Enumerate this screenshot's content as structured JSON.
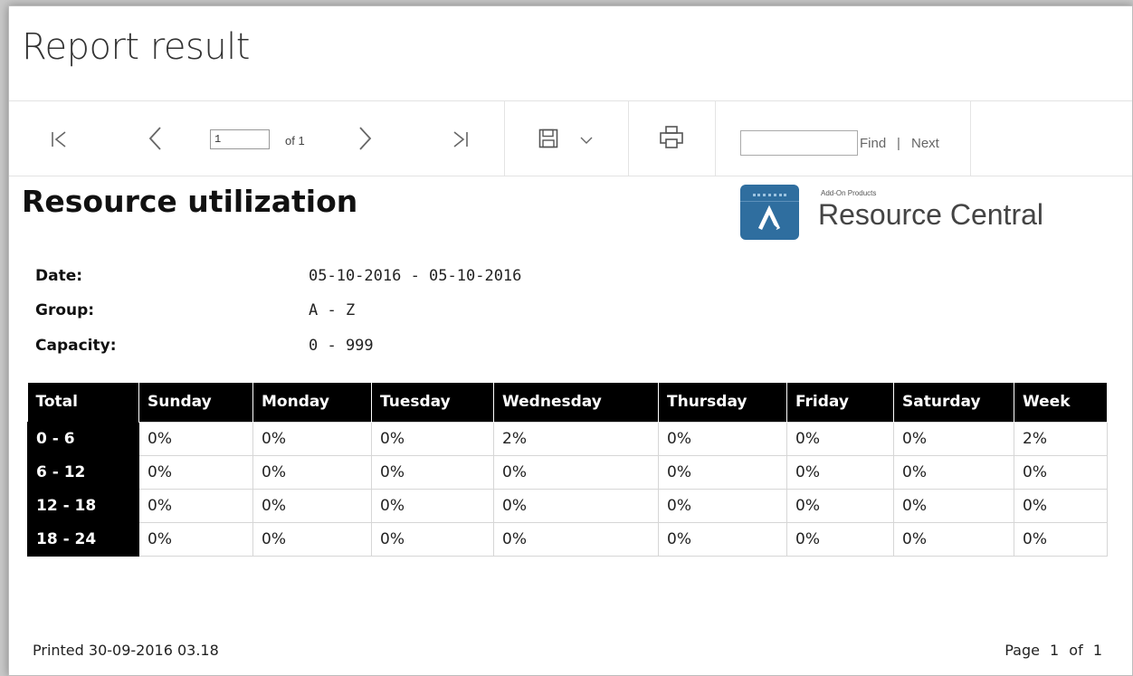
{
  "page_title": "Report result",
  "toolbar": {
    "page_value": "1",
    "of_label": "of 1",
    "find_label": "Find",
    "separator": "|",
    "next_label": "Next"
  },
  "report": {
    "title": "Resource utilization",
    "logo": {
      "small_text": "Add-On Products",
      "name": "Resource Central",
      "color": "#2f6e9f"
    },
    "meta": [
      {
        "label": "Date:",
        "value": "05-10-2016 - 05-10-2016"
      },
      {
        "label": "Group:",
        "value": "A - Z"
      },
      {
        "label": "Capacity:",
        "value": "0 - 999"
      }
    ],
    "table": {
      "headers": [
        "Total",
        "Sunday",
        "Monday",
        "Tuesday",
        "Wednesday",
        "Thursday",
        "Friday",
        "Saturday",
        "Week"
      ],
      "rows": [
        [
          "0 - 6",
          "0%",
          "0%",
          "0%",
          "2%",
          "0%",
          "0%",
          "0%",
          "2%"
        ],
        [
          "6 - 12",
          "0%",
          "0%",
          "0%",
          "0%",
          "0%",
          "0%",
          "0%",
          "0%"
        ],
        [
          "12 - 18",
          "0%",
          "0%",
          "0%",
          "0%",
          "0%",
          "0%",
          "0%",
          "0%"
        ],
        [
          "18 - 24",
          "0%",
          "0%",
          "0%",
          "0%",
          "0%",
          "0%",
          "0%",
          "0%"
        ]
      ]
    },
    "footer": {
      "printed": "Printed 30-09-2016 03.18",
      "page_info": "Page 1 of 1"
    }
  }
}
